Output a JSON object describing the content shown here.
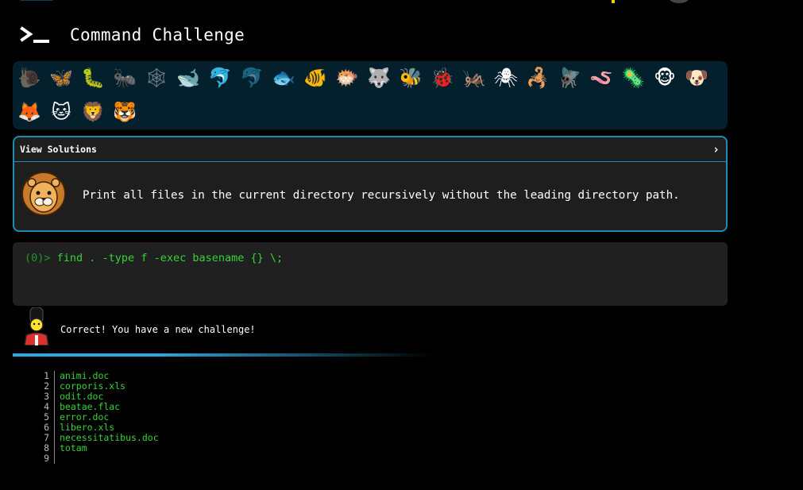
{
  "app": {
    "title": "Command Challenge",
    "logo_icon": "terminal-prompt-icon"
  },
  "animals": [
    {
      "name": "snail",
      "glyph": "🐌",
      "dim": true
    },
    {
      "name": "butterfly",
      "glyph": "🦋",
      "dim": false
    },
    {
      "name": "caterpillar",
      "glyph": "🐛",
      "dim": false
    },
    {
      "name": "ant",
      "glyph": "🐜",
      "dim": false
    },
    {
      "name": "spider-web",
      "glyph": "🕸",
      "dim": true
    },
    {
      "name": "whale",
      "glyph": "🐋",
      "dim": false
    },
    {
      "name": "dolphin",
      "glyph": "🐬",
      "dim": false
    },
    {
      "name": "dolphin-2",
      "glyph": "🐬",
      "dim": true
    },
    {
      "name": "fish",
      "glyph": "🐟",
      "dim": false
    },
    {
      "name": "tropical-fish",
      "glyph": "🐠",
      "dim": false
    },
    {
      "name": "pufferfish",
      "glyph": "🐡",
      "dim": false
    },
    {
      "name": "wolf",
      "glyph": "🐺",
      "dim": false
    },
    {
      "name": "bee",
      "glyph": "🐝",
      "dim": false
    },
    {
      "name": "lady-beetle",
      "glyph": "🐞",
      "dim": false
    },
    {
      "name": "cricket",
      "glyph": "🦗",
      "dim": false
    },
    {
      "name": "spider",
      "glyph": "🕷",
      "dim": false
    },
    {
      "name": "scorpion",
      "glyph": "🦂",
      "dim": false
    },
    {
      "name": "fly",
      "glyph": "🪰",
      "dim": false
    },
    {
      "name": "worm",
      "glyph": "🪱",
      "dim": false
    },
    {
      "name": "microbe",
      "glyph": "🦠",
      "dim": false
    },
    {
      "name": "monkey",
      "glyph": "🐵",
      "dim": false
    },
    {
      "name": "dog",
      "glyph": "🐶",
      "dim": false
    },
    {
      "name": "fox",
      "glyph": "🦊",
      "dim": false
    },
    {
      "name": "cat",
      "glyph": "🐱",
      "dim": false
    },
    {
      "name": "lion",
      "glyph": "🦁",
      "dim": false
    },
    {
      "name": "tiger",
      "glyph": "🐯",
      "dim": false
    }
  ],
  "solutions": {
    "label": "View Solutions",
    "chevron": "›",
    "challenge_text": "Print all files in the current directory recursively without the leading directory path.",
    "avatar_icon": "lion-face-icon"
  },
  "terminal": {
    "prompt": "(0)>",
    "command": "find . -type f -exec basename {} \\;"
  },
  "feedback": {
    "message": "Correct! You have a new challenge!",
    "avatar_icon": "royal-guard-icon"
  },
  "progress": {
    "color": "#2aa8df"
  },
  "output": {
    "lines": [
      {
        "n": "1",
        "text": "animi.doc"
      },
      {
        "n": "2",
        "text": "corporis.xls"
      },
      {
        "n": "3",
        "text": "odit.doc"
      },
      {
        "n": "4",
        "text": "beatae.flac"
      },
      {
        "n": "5",
        "text": "error.doc"
      },
      {
        "n": "6",
        "text": "libero.xls"
      },
      {
        "n": "7",
        "text": "necessitatibus.doc"
      },
      {
        "n": "8",
        "text": "totam"
      },
      {
        "n": "9",
        "text": ""
      }
    ]
  },
  "colors": {
    "accent": "#1f8bb3",
    "command_green": "#35d435",
    "panel_bg": "#04202c"
  }
}
